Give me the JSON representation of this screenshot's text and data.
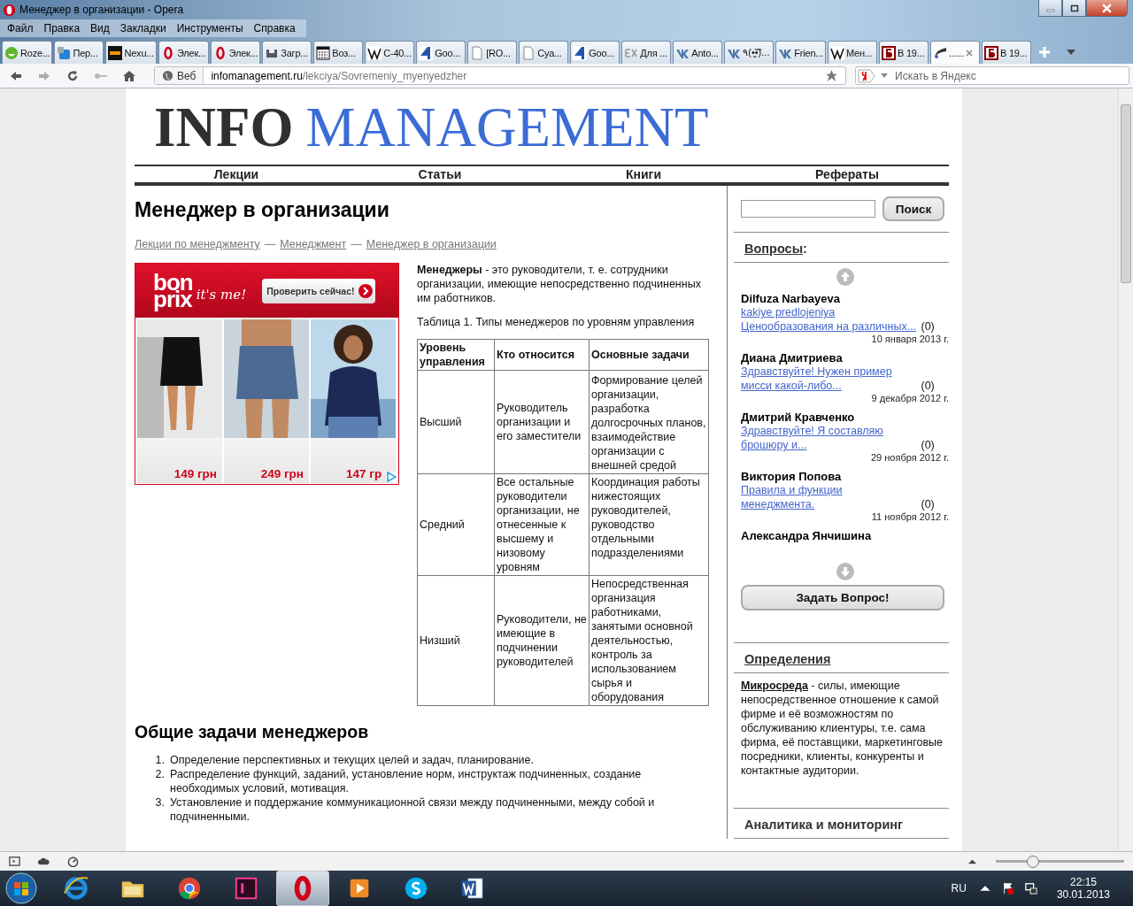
{
  "window": {
    "title": "Менеджер в организации - Opera"
  },
  "menu": [
    "Файл",
    "Правка",
    "Вид",
    "Закладки",
    "Инструменты",
    "Справка"
  ],
  "tabs": [
    {
      "kind": "smiley",
      "label": "Roze...",
      "selected": false
    },
    {
      "kind": "translate",
      "label": "Пер...",
      "selected": false
    },
    {
      "kind": "xda",
      "label": "Nexu...",
      "selected": false
    },
    {
      "kind": "opera",
      "label": "Элек...",
      "selected": false
    },
    {
      "kind": "opera",
      "label": "Элек...",
      "selected": false
    },
    {
      "kind": "download",
      "label": "Загр...",
      "selected": false
    },
    {
      "kind": "calc",
      "label": "Воз...",
      "selected": false
    },
    {
      "kind": "wiki",
      "label": "С-40...",
      "selected": false
    },
    {
      "kind": "four",
      "label": "Goo...",
      "selected": false
    },
    {
      "kind": "page",
      "label": "[RO...",
      "selected": false
    },
    {
      "kind": "page",
      "label": "Суа...",
      "selected": false
    },
    {
      "kind": "four",
      "label": "Goo...",
      "selected": false
    },
    {
      "kind": "ex",
      "label": "Для ...",
      "selected": false
    },
    {
      "kind": "vk",
      "label": "Anto...",
      "selected": false
    },
    {
      "kind": "vk",
      "label": "٩(•̮̮̃•̃)...",
      "selected": false
    },
    {
      "kind": "vk",
      "label": "Frien...",
      "selected": false
    },
    {
      "kind": "wiki",
      "label": "Мен...",
      "selected": false
    },
    {
      "kind": "book",
      "label": "В 19...",
      "selected": false
    },
    {
      "kind": "swoosh",
      "label": "......",
      "selected": true
    },
    {
      "kind": "book",
      "label": "В 19...",
      "selected": false
    }
  ],
  "address": {
    "badge": "Веб",
    "host": "infomanagement.ru",
    "path": "/lekciya/Sovremeniy_myenyedzher",
    "search_placeholder": "Искать в Яндекс"
  },
  "site": {
    "logo_dark": "INFO",
    "logo_blue": "MANAGEMENT",
    "nav": [
      "Лекции",
      "Статьи",
      "Книги",
      "Рефераты"
    ]
  },
  "article": {
    "title": "Менеджер в организации",
    "breadcrumb": [
      "Лекции по менеджменту",
      "Менеджмент",
      "Менеджер в организации"
    ],
    "separator": "—",
    "ad": {
      "brand_top": "bon",
      "brand_bottom": "prix",
      "slogan": "it's me!",
      "button": "Проверить сейчас!",
      "prices": [
        "149 грн",
        "249 грн",
        "147 гр"
      ]
    },
    "intro": "**Менеджеры** - это руководители, т. е. сотрудники организации, имеющие непосредственно подчиненных им работников.",
    "table_caption": "Таблица 1. Типы менеджеров по уровням управления",
    "table": {
      "columns": [
        "Уровень управления",
        "Кто относится",
        "Основные задачи"
      ],
      "rows": [
        [
          "Высший",
          "Руководитель организации и его заместители",
          "Формирование целей организации, разработка долгосрочных планов, взаимодействие организации с внешней средой"
        ],
        [
          "Средний",
          "Все остальные руководители организации, не отнесенные к высшему и низовому уровням",
          "Координация работы нижестоящих руководителей, руководство отдельными подразделениями"
        ],
        [
          "Низший",
          "Руководители, не имеющие в подчинении руководителей",
          "Непосредственная организация работниками, занятыми основной деятельностью, контроль за использованием сырья и оборудования"
        ]
      ]
    },
    "section_title": "Общие задачи менеджеров",
    "tasks": [
      {
        "number": "1.",
        "text": "Определение перспективных и текущих целей и задач, планирование."
      },
      {
        "number": "2.",
        "text": "Распределение функций, заданий, установление норм, инструктаж подчиненных, создание необходимых условий, мотивация."
      },
      {
        "number": "3.",
        "text": "Установление и поддержание коммуникационной связи между подчиненными, между собой и подчиненными."
      }
    ]
  },
  "sidebar": {
    "search_button": "Поиск",
    "questions_title": "Вопросы",
    "questions_suffix": ":",
    "questions": [
      {
        "author": "Dilfuza Narbayeva",
        "link": "kakiye predlojeniya Ценообразования на различных...",
        "count": "(0)",
        "date": "10 января 2013 г."
      },
      {
        "author": "Диана Дмитриева",
        "link": "Здравствуйте! Нужен пример мисси какой-либо...",
        "count": "(0)",
        "date": "9 декабря 2012 г."
      },
      {
        "author": "Дмитрий Кравченко",
        "link": "Здравствуйте! Я составляю брошюру и...",
        "count": "(0)",
        "date": "29 ноября 2012 г."
      },
      {
        "author": "Виктория Попова",
        "link": "Правила и функции менеджмента.",
        "count": "(0)",
        "date": "11 ноября 2012 г."
      },
      {
        "author": "Александра Янчишина"
      }
    ],
    "ask_button": "Задать Вопрос!",
    "definitions_title": "Определения",
    "definition_term": "Микросреда",
    "definition_text": " - силы, имеющие непосредственное отношение к самой фирме и её возможностям по обслуживанию клиентуры, т.е. сама фирма, её поставщики, маркетинговые посредники, клиенты, конкуренты и контактные аудитории.",
    "analytics_title": "Аналитика и мониторинг"
  },
  "status_bar": {
    "zoom": {
      "level": 0.29
    }
  },
  "taskbar": {
    "apps": [
      {
        "kind": "ie",
        "selected": false
      },
      {
        "kind": "folder",
        "selected": false
      },
      {
        "kind": "chrome",
        "selected": false
      },
      {
        "kind": "indesign",
        "selected": false
      },
      {
        "kind": "opera",
        "selected": true
      },
      {
        "kind": "player",
        "selected": false
      },
      {
        "kind": "skype",
        "selected": false
      },
      {
        "kind": "word",
        "selected": false
      }
    ],
    "lang": "RU",
    "time": "22:15",
    "date": "30.01.2013"
  }
}
